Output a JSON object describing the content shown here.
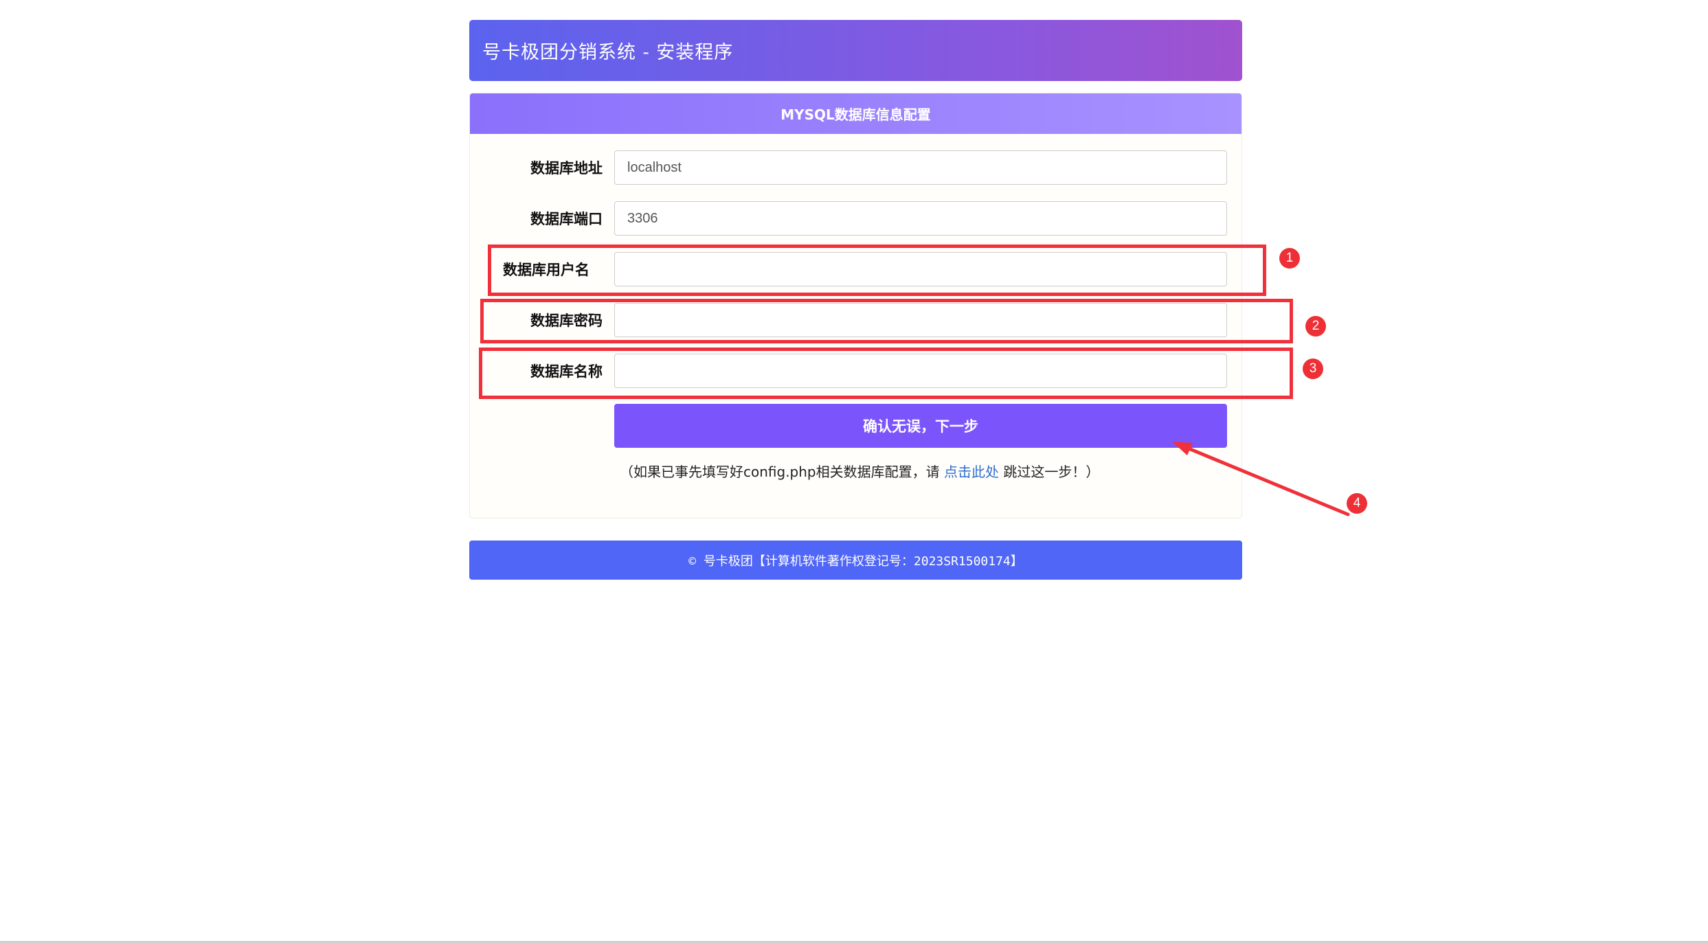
{
  "header": {
    "title": "号卡极团分销系统 - 安装程序"
  },
  "panel": {
    "title": "MYSQL数据库信息配置"
  },
  "form": {
    "fields": [
      {
        "label": "数据库地址",
        "value": "localhost",
        "placeholder": ""
      },
      {
        "label": "数据库端口",
        "value": "3306",
        "placeholder": ""
      },
      {
        "label": "数据库用户名",
        "value": "",
        "placeholder": ""
      },
      {
        "label": "数据库密码",
        "value": "",
        "placeholder": ""
      },
      {
        "label": "数据库名称",
        "value": "",
        "placeholder": ""
      }
    ],
    "submit_label": "确认无误，下一步",
    "hint_prefix": "（如果已事先填写好config.php相关数据库配置，请 ",
    "hint_link": "点击此处",
    "hint_suffix": " 跳过这一步！）"
  },
  "footer": {
    "text": "© 号卡极团【计算机软件著作权登记号：2023SR1500174】"
  },
  "annotations": {
    "color": "#f0303a",
    "markers": [
      "1",
      "2",
      "3",
      "4"
    ]
  },
  "colors": {
    "header_gradient": [
      "#5b63ee",
      "#a052cf"
    ],
    "button": "#7b55fb",
    "footer": "#4f66f6",
    "link": "#2d6ccf"
  }
}
